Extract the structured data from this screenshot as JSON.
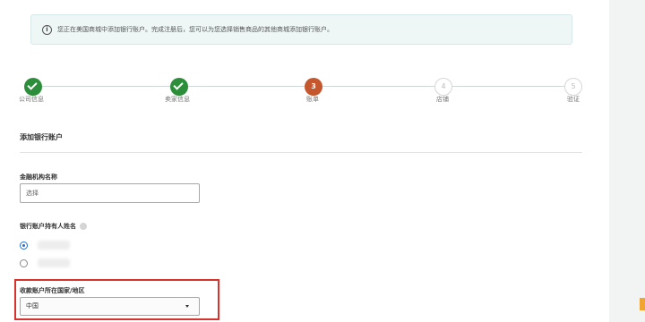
{
  "banner": {
    "icon": "info-icon",
    "text": "您正在美国商城中添加银行账户。完成注册后，您可以为您选择销售商品的其他商城添加银行账户。"
  },
  "stepper": {
    "steps": [
      {
        "label": "公司信息",
        "state": "done",
        "number": ""
      },
      {
        "label": "卖家信息",
        "state": "done",
        "number": ""
      },
      {
        "label": "账单",
        "state": "current",
        "number": "3"
      },
      {
        "label": "店铺",
        "state": "future",
        "number": "4"
      },
      {
        "label": "验证",
        "state": "future",
        "number": "5"
      }
    ]
  },
  "form": {
    "section_title": "添加银行账户",
    "institution": {
      "label": "金融机构名称",
      "value": "选择"
    },
    "holder": {
      "label": "银行账户持有人姓名",
      "help_icon": "help-icon",
      "options": [
        {
          "selected": true
        },
        {
          "selected": false
        }
      ]
    },
    "country": {
      "label": "收款账户所在国家/地区",
      "value": "中国",
      "icon": "caret-down-icon"
    }
  },
  "colors": {
    "done": "#2c8d3a",
    "current": "#c4572d",
    "highlight": "#d9312b",
    "radio": "#1e6fd9",
    "accent": "#f0a531"
  }
}
